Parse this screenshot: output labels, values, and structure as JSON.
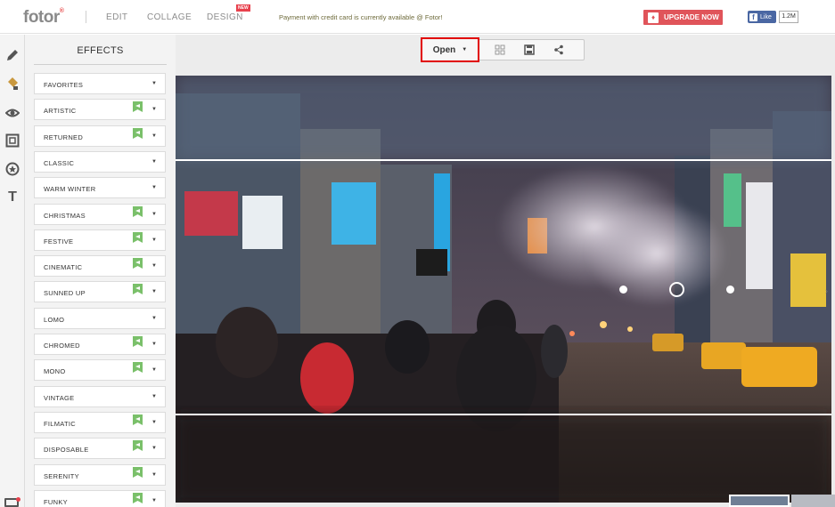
{
  "header": {
    "logo": "fotor",
    "logo_mark": "®",
    "nav": [
      "EDIT",
      "COLLAGE",
      "DESIGN"
    ],
    "new_badge": "NEW",
    "announcement": "Payment with credit card is currently available @ Fotor!",
    "upgrade_label": "UPGRADE NOW",
    "fb_like_label": "Like",
    "fb_count": "1.2M"
  },
  "sidebar": {
    "tools": [
      "pencil-icon",
      "paint-bucket-icon",
      "eye-icon",
      "frame-icon",
      "sticker-icon",
      "text-icon"
    ],
    "text_tool_glyph": "T"
  },
  "effects": {
    "title": "EFFECTS",
    "items": [
      {
        "label": "FAVORITES",
        "premium": false
      },
      {
        "label": "ARTISTIC",
        "premium": true
      },
      {
        "label": "RETURNED",
        "premium": true
      },
      {
        "label": "CLASSIC",
        "premium": false
      },
      {
        "label": "WARM WINTER",
        "premium": false
      },
      {
        "label": "CHRISTMAS",
        "premium": true
      },
      {
        "label": "FESTIVE",
        "premium": true
      },
      {
        "label": "CINEMATIC",
        "premium": true
      },
      {
        "label": "SUNNED UP",
        "premium": true
      },
      {
        "label": "LOMO",
        "premium": false
      },
      {
        "label": "CHROMED",
        "premium": true
      },
      {
        "label": "MONO",
        "premium": true
      },
      {
        "label": "VINTAGE",
        "premium": false
      },
      {
        "label": "FILMATIC",
        "premium": true
      },
      {
        "label": "DISPOSABLE",
        "premium": true
      },
      {
        "label": "SERENITY",
        "premium": true
      },
      {
        "label": "FUNKY",
        "premium": true
      }
    ]
  },
  "toolbar": {
    "open_label": "Open",
    "icons": [
      "compare-icon",
      "save-icon",
      "share-icon"
    ]
  },
  "colors": {
    "accent": "#e0545a",
    "highlight_border": "#e10000",
    "premium_badge": "#7ac06a"
  }
}
